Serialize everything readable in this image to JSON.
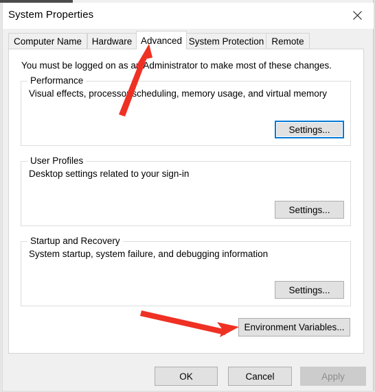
{
  "window": {
    "title": "System Properties",
    "close_icon": "close-icon"
  },
  "tabs": [
    {
      "label": "Computer Name",
      "active": false
    },
    {
      "label": "Hardware",
      "active": false
    },
    {
      "label": "Advanced",
      "active": true
    },
    {
      "label": "System Protection",
      "active": false
    },
    {
      "label": "Remote",
      "active": false
    }
  ],
  "content": {
    "intro": "You must be logged on as an Administrator to make most of these changes.",
    "groups": [
      {
        "label": "Performance",
        "description": "Visual effects, processor scheduling, memory usage, and virtual memory",
        "button": "Settings...",
        "button_state": "focused"
      },
      {
        "label": "User Profiles",
        "description": "Desktop settings related to your sign-in",
        "button": "Settings...",
        "button_state": "normal"
      },
      {
        "label": "Startup and Recovery",
        "description": "System startup, system failure, and debugging information",
        "button": "Settings...",
        "button_state": "normal"
      }
    ],
    "environment_variables_button": "Environment Variables..."
  },
  "footer": {
    "ok": "OK",
    "cancel": "Cancel",
    "apply": "Apply",
    "apply_state": "disabled"
  },
  "annotations": {
    "arrow_color": "#ef3124",
    "arrows": [
      {
        "name": "arrow-to-advanced-tab",
        "target": "Advanced"
      },
      {
        "name": "arrow-to-environment-variables",
        "target": "Environment Variables..."
      }
    ]
  },
  "colors": {
    "accent": "#0078d7",
    "window_bg": "#f0f0f0",
    "panel_bg": "#ffffff",
    "button_bg": "#e1e1e1",
    "button_border": "#adadad",
    "disabled_bg": "#cccccc",
    "disabled_text": "#8d8d8d",
    "group_border": "#dcdcdc"
  }
}
